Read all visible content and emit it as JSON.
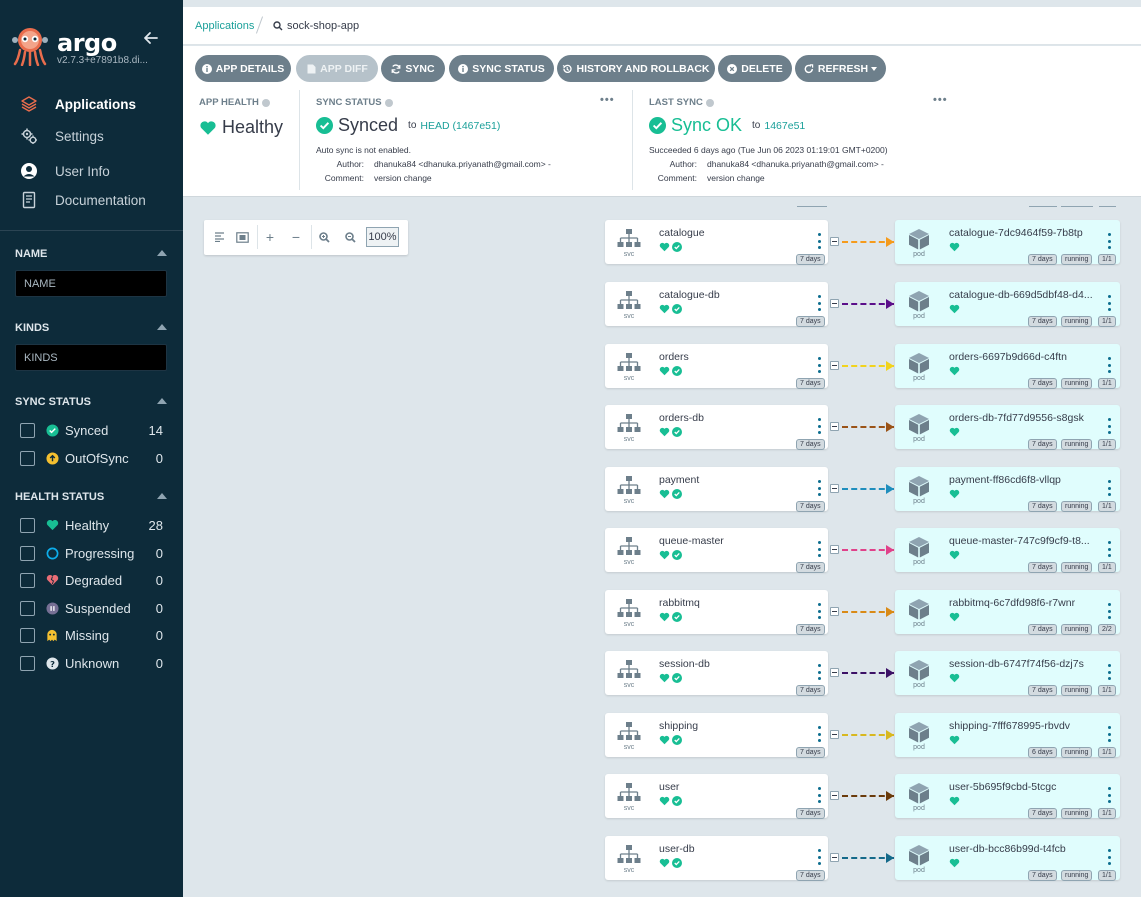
{
  "sidebar": {
    "brand": "argo",
    "version": "v2.7.3+e7891b8.di...",
    "nav": [
      {
        "label": "Applications",
        "icon": "layers-icon"
      },
      {
        "label": "Settings",
        "icon": "gears-icon"
      },
      {
        "label": "User Info",
        "icon": "user-icon"
      },
      {
        "label": "Documentation",
        "icon": "book-icon"
      }
    ],
    "name_filter": {
      "title": "NAME",
      "placeholder": "NAME"
    },
    "kinds_filter": {
      "title": "KINDS",
      "placeholder": "KINDS"
    },
    "sync_status": {
      "title": "SYNC STATUS",
      "items": [
        {
          "label": "Synced",
          "count": "14"
        },
        {
          "label": "OutOfSync",
          "count": "0"
        }
      ]
    },
    "health_status": {
      "title": "HEALTH STATUS",
      "items": [
        {
          "label": "Healthy",
          "count": "28"
        },
        {
          "label": "Progressing",
          "count": "0"
        },
        {
          "label": "Degraded",
          "count": "0"
        },
        {
          "label": "Suspended",
          "count": "0"
        },
        {
          "label": "Missing",
          "count": "0"
        },
        {
          "label": "Unknown",
          "count": "0"
        }
      ]
    }
  },
  "breadcrumb": {
    "apps": "Applications",
    "current": "sock-shop-app"
  },
  "toolbar": {
    "app_details": "APP DETAILS",
    "app_diff": "APP DIFF",
    "sync": "SYNC",
    "sync_status": "SYNC STATUS",
    "history": "HISTORY AND ROLLBACK",
    "delete": "DELETE",
    "refresh": "REFRESH"
  },
  "status": {
    "app_health": {
      "label": "APP HEALTH",
      "value": "Healthy"
    },
    "sync_status": {
      "label": "SYNC STATUS",
      "value": "Synced",
      "to": "to",
      "revision": "HEAD (1467e51)",
      "note": "Auto sync is not enabled.",
      "author_key": "Author:",
      "author": "dhanuka84 <dhanuka.priyanath@gmail.com> -",
      "comment_key": "Comment:",
      "comment": "version change"
    },
    "last_sync": {
      "label": "LAST SYNC",
      "value": "Sync OK",
      "to": "to",
      "revision": "1467e51",
      "note": "Succeeded 6 days ago (Tue Jun 06 2023 01:19:01 GMT+0200)",
      "author_key": "Author:",
      "author": "dhanuka84 <dhanuka.priyanath@gmail.com> -",
      "comment_key": "Comment:",
      "comment": "version change"
    }
  },
  "zoom": {
    "level": "100%"
  },
  "colors": {
    "accent": "#18be94",
    "link": "#1ba09a",
    "button": "#6d7f8b",
    "sidebar": "#0d2b3a"
  },
  "resources": [
    {
      "svc": "catalogue",
      "svc_age": "7 days",
      "pod": "catalogue-7dc9464f59-7b8tp",
      "pod_age": "7 days",
      "pod_status": "running",
      "pod_ready": "1/1",
      "edge": "#f59b1c"
    },
    {
      "svc": "catalogue-db",
      "svc_age": "7 days",
      "pod": "catalogue-db-669d5dbf48-d4...",
      "pod_age": "7 days",
      "pod_status": "running",
      "pod_ready": "1/1",
      "edge": "#5b0f8a"
    },
    {
      "svc": "orders",
      "svc_age": "7 days",
      "pod": "orders-6697b9d66d-c4ftn",
      "pod_age": "7 days",
      "pod_status": "running",
      "pod_ready": "1/1",
      "edge": "#f1d31d"
    },
    {
      "svc": "orders-db",
      "svc_age": "7 days",
      "pod": "orders-db-7fd77d9556-s8gsk",
      "pod_age": "7 days",
      "pod_status": "running",
      "pod_ready": "1/1",
      "edge": "#9a5317"
    },
    {
      "svc": "payment",
      "svc_age": "7 days",
      "pod": "payment-ff86cd6f8-vllqp",
      "pod_age": "7 days",
      "pod_status": "running",
      "pod_ready": "1/1",
      "edge": "#1f8ebd"
    },
    {
      "svc": "queue-master",
      "svc_age": "7 days",
      "pod": "queue-master-747c9f9cf9-t8...",
      "pod_age": "7 days",
      "pod_status": "running",
      "pod_ready": "1/1",
      "edge": "#e0418a"
    },
    {
      "svc": "rabbitmq",
      "svc_age": "7 days",
      "pod": "rabbitmq-6c7dfd98f6-r7wnr",
      "pod_age": "7 days",
      "pod_status": "running",
      "pod_ready": "2/2",
      "edge": "#d98a16"
    },
    {
      "svc": "session-db",
      "svc_age": "7 days",
      "pod": "session-db-6747f74f56-dzj7s",
      "pod_age": "7 days",
      "pod_status": "running",
      "pod_ready": "1/1",
      "edge": "#3c1166"
    },
    {
      "svc": "shipping",
      "svc_age": "7 days",
      "pod": "shipping-7fff678995-rbvdv",
      "pod_age": "6 days",
      "pod_status": "running",
      "pod_ready": "1/1",
      "edge": "#d8b81f"
    },
    {
      "svc": "user",
      "svc_age": "7 days",
      "pod": "user-5b695f9cbd-5tcgc",
      "pod_age": "7 days",
      "pod_status": "running",
      "pod_ready": "1/1",
      "edge": "#6a3b0b"
    },
    {
      "svc": "user-db",
      "svc_age": "7 days",
      "pod": "user-db-bcc86b99d-t4fcb",
      "pod_age": "7 days",
      "pod_status": "running",
      "pod_ready": "1/1",
      "edge": "#156a8a"
    }
  ],
  "node_types": {
    "svc": "svc",
    "pod": "pod"
  }
}
